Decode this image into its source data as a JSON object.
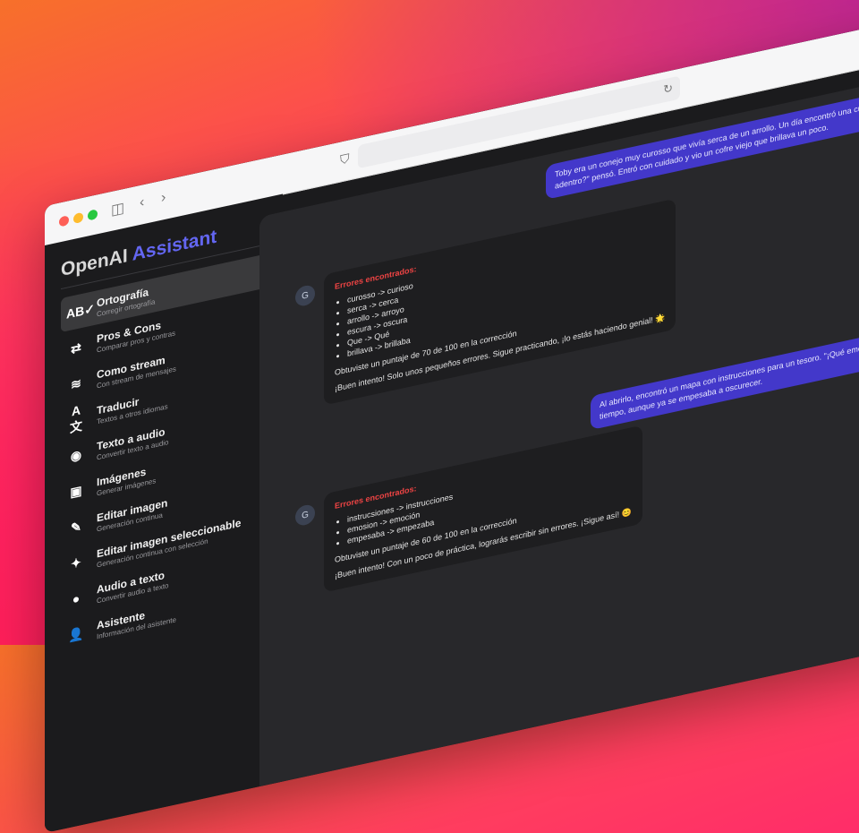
{
  "sidebar": {
    "title_main": "OpenAI",
    "title_accent": "Assistant",
    "items": [
      {
        "label": "Ortografía",
        "sub": "Corregir ortografía",
        "icon": "spellcheck-icon",
        "glyph": "AB✓"
      },
      {
        "label": "Pros & Cons",
        "sub": "Comparar pros y contras",
        "icon": "compare-arrows-icon",
        "glyph": "⇄"
      },
      {
        "label": "Como stream",
        "sub": "Con stream de mensajes",
        "icon": "stream-waves-icon",
        "glyph": "≋"
      },
      {
        "label": "Traducir",
        "sub": "Textos a otros idiomas",
        "icon": "translate-icon",
        "glyph": "A文"
      },
      {
        "label": "Texto a audio",
        "sub": "Convertir texto a audio",
        "icon": "podcast-icon",
        "glyph": "◉"
      },
      {
        "label": "Imágenes",
        "sub": "Generar imágenes",
        "icon": "image-icon",
        "glyph": "▣"
      },
      {
        "label": "Editar imagen",
        "sub": "Generación continua",
        "icon": "pencil-icon",
        "glyph": "✎"
      },
      {
        "label": "Editar imagen seleccionable",
        "sub": "Generación continua con selección",
        "icon": "magic-wand-icon",
        "glyph": "✦"
      },
      {
        "label": "Audio a texto",
        "sub": "Convertir audio a texto",
        "icon": "chat-bubble-icon",
        "glyph": "●"
      },
      {
        "label": "Asistente",
        "sub": "Información del asistente",
        "icon": "user-icon",
        "glyph": "👤"
      }
    ]
  },
  "chat": {
    "messages": [
      {
        "role": "user",
        "text": "Toby era un conejo muy curosso que vivía serca de un arrollo. Un día encontró una cueva escura entre las rocas. \"¿Que habrá adentro?\" pensó. Entró con cuidado y vio un cofre viejo que brillava un poco."
      },
      {
        "role": "assistant",
        "avatar": "G",
        "title": "Errores encontrados:",
        "errors": [
          "curosso -> curioso",
          "serca -> cerca",
          "arrollo -> arroyo",
          "escura -> oscura",
          "Que -> Qué",
          "brillava -> brillaba"
        ],
        "score": "Obtuviste un puntaje de 70 de 100 en la corrección",
        "message": "¡Buen intento! Solo unos pequeños errores. Sigue practicando, ¡lo estás haciendo genial! 🌟"
      },
      {
        "role": "user",
        "text": "Al abrirlo, encontró un mapa con instrucciones para un tesoro. \"¡Qué emosión!\" pensó. Siguió el mapa sin perder más tiempo, aunque ya se empesaba a oscurecer."
      },
      {
        "role": "assistant",
        "avatar": "G",
        "title": "Errores encontrados:",
        "errors": [
          "instrucsiones -> instrucciones",
          "emosion -> emoción",
          "empesaba -> empezaba"
        ],
        "score": "Obtuviste un puntaje de 60 de 100 en la corrección",
        "message": "¡Buen intento! Con un poco de práctica, lograrás escribir sin errores. ¡Sigue así! 😊"
      }
    ]
  },
  "colors": {
    "accent": "#6366f1",
    "user_bubble": "#4338ca",
    "error": "#ef4444"
  }
}
